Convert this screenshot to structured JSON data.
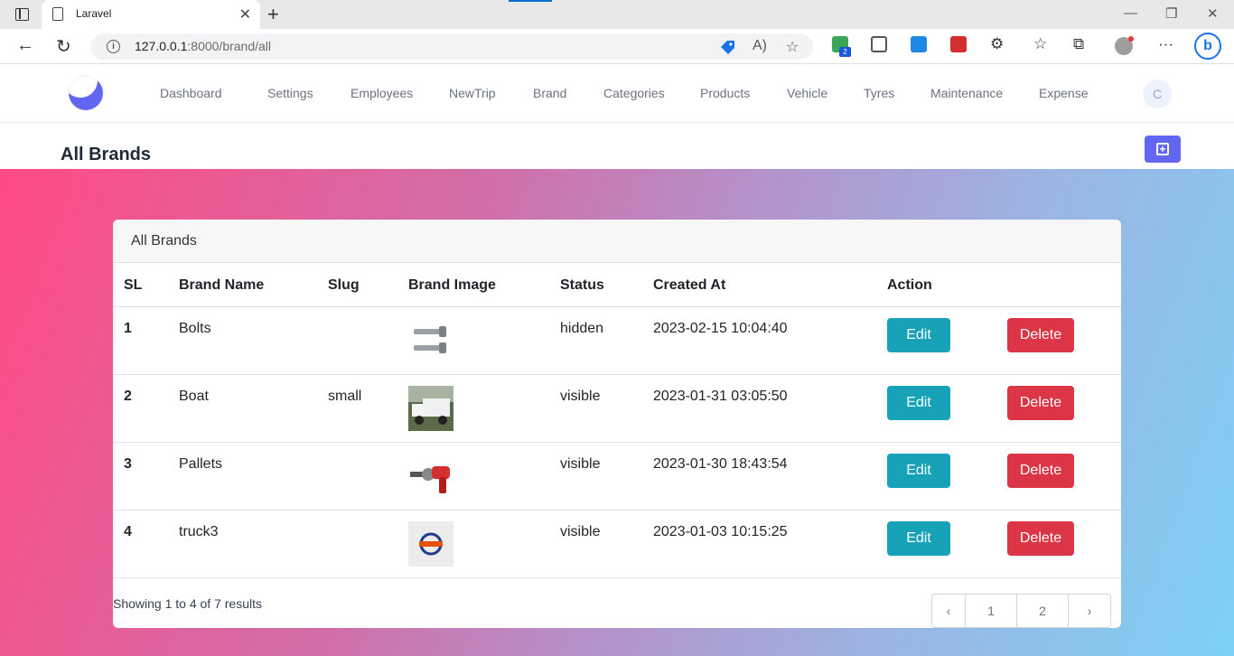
{
  "browser": {
    "tab_title": "Laravel",
    "url_host": "127.0.0.1",
    "url_rest": ":8000/brand/all",
    "extension_badge": "2"
  },
  "nav": {
    "items": [
      "Dashboard",
      "Settings",
      "Employees",
      "NewTrip",
      "Brand",
      "Categories",
      "Products",
      "Vehicle",
      "Tyres",
      "Maintenance",
      "Expense"
    ],
    "avatar_initial": "C"
  },
  "page": {
    "title": "All Brands"
  },
  "card": {
    "header": "All Brands",
    "columns": [
      "SL",
      "Brand Name",
      "Slug",
      "Brand Image",
      "Status",
      "Created At",
      "Action"
    ],
    "rows": [
      {
        "sl": "1",
        "name": "Bolts",
        "slug": "",
        "image": "bolts",
        "status": "hidden",
        "created_at": "2023-02-15 10:04:40",
        "edit": "Edit",
        "delete": "Delete"
      },
      {
        "sl": "2",
        "name": "Boat",
        "slug": "small",
        "image": "truck",
        "status": "visible",
        "created_at": "2023-01-31 03:05:50",
        "edit": "Edit",
        "delete": "Delete"
      },
      {
        "sl": "3",
        "name": "Pallets",
        "slug": "",
        "image": "tool",
        "status": "visible",
        "created_at": "2023-01-30 18:43:54",
        "edit": "Edit",
        "delete": "Delete"
      },
      {
        "sl": "4",
        "name": "truck3",
        "slug": "",
        "image": "logo",
        "status": "visible",
        "created_at": "2023-01-03 10:15:25",
        "edit": "Edit",
        "delete": "Delete"
      }
    ],
    "showing": "Showing 1 to 4 of 7 results",
    "pages": [
      "1",
      "2"
    ]
  },
  "colors": {
    "primary": "#6366f1",
    "edit": "#17a2b8",
    "delete": "#dc3545"
  }
}
